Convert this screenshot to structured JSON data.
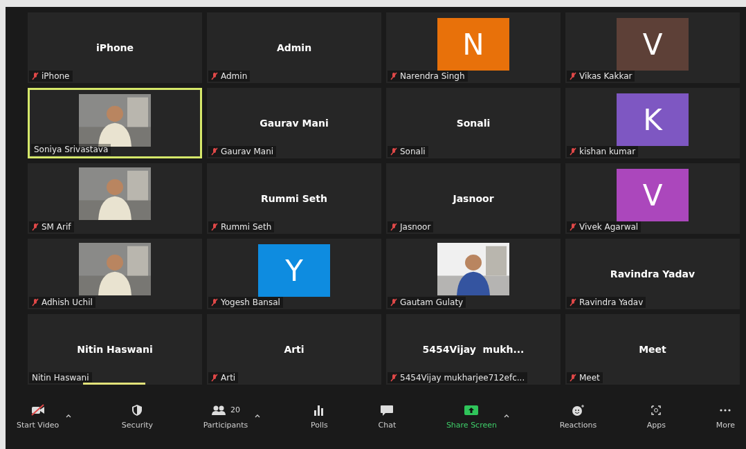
{
  "tiles": [
    {
      "kind": "name",
      "title": "iPhone",
      "label": "iPhone",
      "muted": true,
      "active_speaker": false,
      "speaking": false
    },
    {
      "kind": "name",
      "title": "Admin",
      "label": "Admin",
      "muted": true,
      "active_speaker": false,
      "speaking": false
    },
    {
      "kind": "avatar",
      "letter": "N",
      "color": "#e8710a",
      "label": "Narendra Singh",
      "muted": true,
      "active_speaker": false,
      "speaking": false
    },
    {
      "kind": "avatar",
      "letter": "V",
      "color": "#5d4037",
      "label": "Vikas Kakkar",
      "muted": true,
      "active_speaker": false,
      "speaking": false
    },
    {
      "kind": "picture",
      "label": "Soniya Srivastava",
      "muted": false,
      "active_speaker": true,
      "speaking": false
    },
    {
      "kind": "name",
      "title": "Gaurav Mani",
      "label": "Gaurav Mani",
      "muted": true,
      "active_speaker": false,
      "speaking": false
    },
    {
      "kind": "name",
      "title": "Sonali",
      "label": "Sonali",
      "muted": true,
      "active_speaker": false,
      "speaking": false
    },
    {
      "kind": "avatar",
      "letter": "K",
      "color": "#7e57c2",
      "label": "kishan kumar",
      "muted": true,
      "active_speaker": false,
      "speaking": false
    },
    {
      "kind": "picture",
      "label": "SM Arif",
      "muted": true,
      "active_speaker": false,
      "speaking": false
    },
    {
      "kind": "name",
      "title": "Rummi Seth",
      "label": "Rummi Seth",
      "muted": true,
      "active_speaker": false,
      "speaking": false
    },
    {
      "kind": "name",
      "title": "Jasnoor",
      "label": "Jasnoor",
      "muted": true,
      "active_speaker": false,
      "speaking": false
    },
    {
      "kind": "avatar",
      "letter": "V",
      "color": "#ab47bc",
      "label": "Vivek Agarwal",
      "muted": true,
      "active_speaker": false,
      "speaking": false
    },
    {
      "kind": "picture",
      "label": "Adhish Uchil",
      "muted": true,
      "active_speaker": false,
      "speaking": false
    },
    {
      "kind": "avatar",
      "letter": "Y",
      "color": "#0e8ce0",
      "label": "Yogesh Bansal",
      "muted": true,
      "active_speaker": false,
      "speaking": false
    },
    {
      "kind": "picture",
      "label": "Gautam Gulaty",
      "muted": true,
      "active_speaker": false,
      "speaking": false
    },
    {
      "kind": "name",
      "title": "Ravindra Yadav",
      "label": "Ravindra Yadav",
      "muted": true,
      "active_speaker": false,
      "speaking": false
    },
    {
      "kind": "name",
      "title": "Nitin Haswani",
      "label": "Nitin Haswani",
      "muted": false,
      "active_speaker": false,
      "speaking": true
    },
    {
      "kind": "name",
      "title": "Arti",
      "label": "Arti",
      "muted": true,
      "active_speaker": false,
      "speaking": false
    },
    {
      "kind": "name",
      "title": "5454Vijay  mukh...",
      "label": "5454Vijay mukharjee712efc...",
      "muted": true,
      "active_speaker": false,
      "speaking": false
    },
    {
      "kind": "name",
      "title": "Meet",
      "label": "Meet",
      "muted": true,
      "active_speaker": false,
      "speaking": false
    }
  ],
  "toolbar": [
    {
      "kind": "video",
      "label": "Start Video",
      "caret": true
    },
    {
      "kind": "security",
      "label": "Security",
      "caret": false
    },
    {
      "kind": "participants",
      "label": "Participants",
      "count": "20",
      "caret": true
    },
    {
      "kind": "polls",
      "label": "Polls",
      "caret": false
    },
    {
      "kind": "chat",
      "label": "Chat",
      "caret": false
    },
    {
      "kind": "share",
      "label": "Share Screen",
      "caret": true
    },
    {
      "kind": "reactions",
      "label": "Reactions",
      "caret": false
    },
    {
      "kind": "apps",
      "label": "Apps",
      "caret": false
    },
    {
      "kind": "more",
      "label": "More",
      "caret": false
    }
  ]
}
